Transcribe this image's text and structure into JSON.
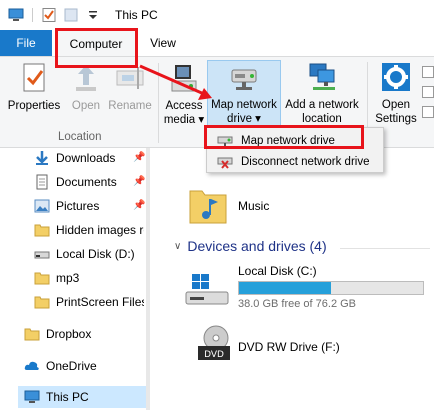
{
  "titlebar": {
    "title": "This PC",
    "quick_access": [
      "computer-icon",
      "properties-check-icon",
      "new-folder-icon",
      "customize-dropdown-icon"
    ]
  },
  "tabs": {
    "file": "File",
    "computer": "Computer",
    "view": "View"
  },
  "ribbon": {
    "location_group": {
      "label": "Location",
      "buttons": [
        {
          "label": "Properties",
          "icon": "properties-icon",
          "enabled": true
        },
        {
          "label": "Open",
          "icon": "open-icon",
          "enabled": false
        },
        {
          "label": "Rename",
          "icon": "rename-icon",
          "enabled": false
        }
      ]
    },
    "network_group": {
      "access_media": {
        "line1": "Access",
        "line2": "media ▾"
      },
      "map_network_drive": {
        "line1": "Map network",
        "line2": "drive ▾"
      },
      "add_network_location": {
        "line1": "Add a network",
        "line2": "location"
      }
    },
    "system_group": {
      "open_settings": {
        "line1": "Open",
        "line2": "Settings"
      }
    }
  },
  "dropdown": {
    "items": [
      {
        "label": "Map network drive",
        "icon": "map-drive-icon"
      },
      {
        "label": "Disconnect network drive",
        "icon": "disconnect-drive-icon"
      }
    ]
  },
  "nav": {
    "items": [
      {
        "label": "Downloads",
        "icon": "download-arrow-icon",
        "pinned": true
      },
      {
        "label": "Documents",
        "icon": "documents-icon",
        "pinned": true
      },
      {
        "label": "Pictures",
        "icon": "pictures-icon",
        "pinned": true
      },
      {
        "label": "Hidden images re",
        "icon": "folder-icon",
        "pinned": false
      },
      {
        "label": "Local Disk (D:)",
        "icon": "drive-icon",
        "pinned": false
      },
      {
        "label": "mp3",
        "icon": "folder-icon",
        "pinned": false
      },
      {
        "label": "PrintScreen Files",
        "icon": "folder-icon",
        "pinned": false
      },
      {
        "label": "Dropbox",
        "icon": "dropbox-folder-icon",
        "pinned": false
      },
      {
        "label": "OneDrive",
        "icon": "onedrive-cloud-icon",
        "pinned": false
      },
      {
        "label": "This PC",
        "icon": "computer-icon",
        "pinned": false,
        "selected": true
      }
    ]
  },
  "content": {
    "folders": [
      {
        "label": "Music",
        "icon": "music-folder-icon"
      }
    ],
    "devices_section": "Devices and drives (4)",
    "drives": [
      {
        "name": "Local Disk (C:)",
        "free_text": "38.0 GB free of 76.2 GB",
        "used_fraction": 0.5
      },
      {
        "name": "DVD RW Drive (F:)",
        "icon": "dvd-drive-icon"
      }
    ]
  },
  "colors": {
    "accent": "#1979ca",
    "highlight": "#cce4f7",
    "annotation_red": "#e8141b",
    "drive_fill": "#26a0da"
  }
}
